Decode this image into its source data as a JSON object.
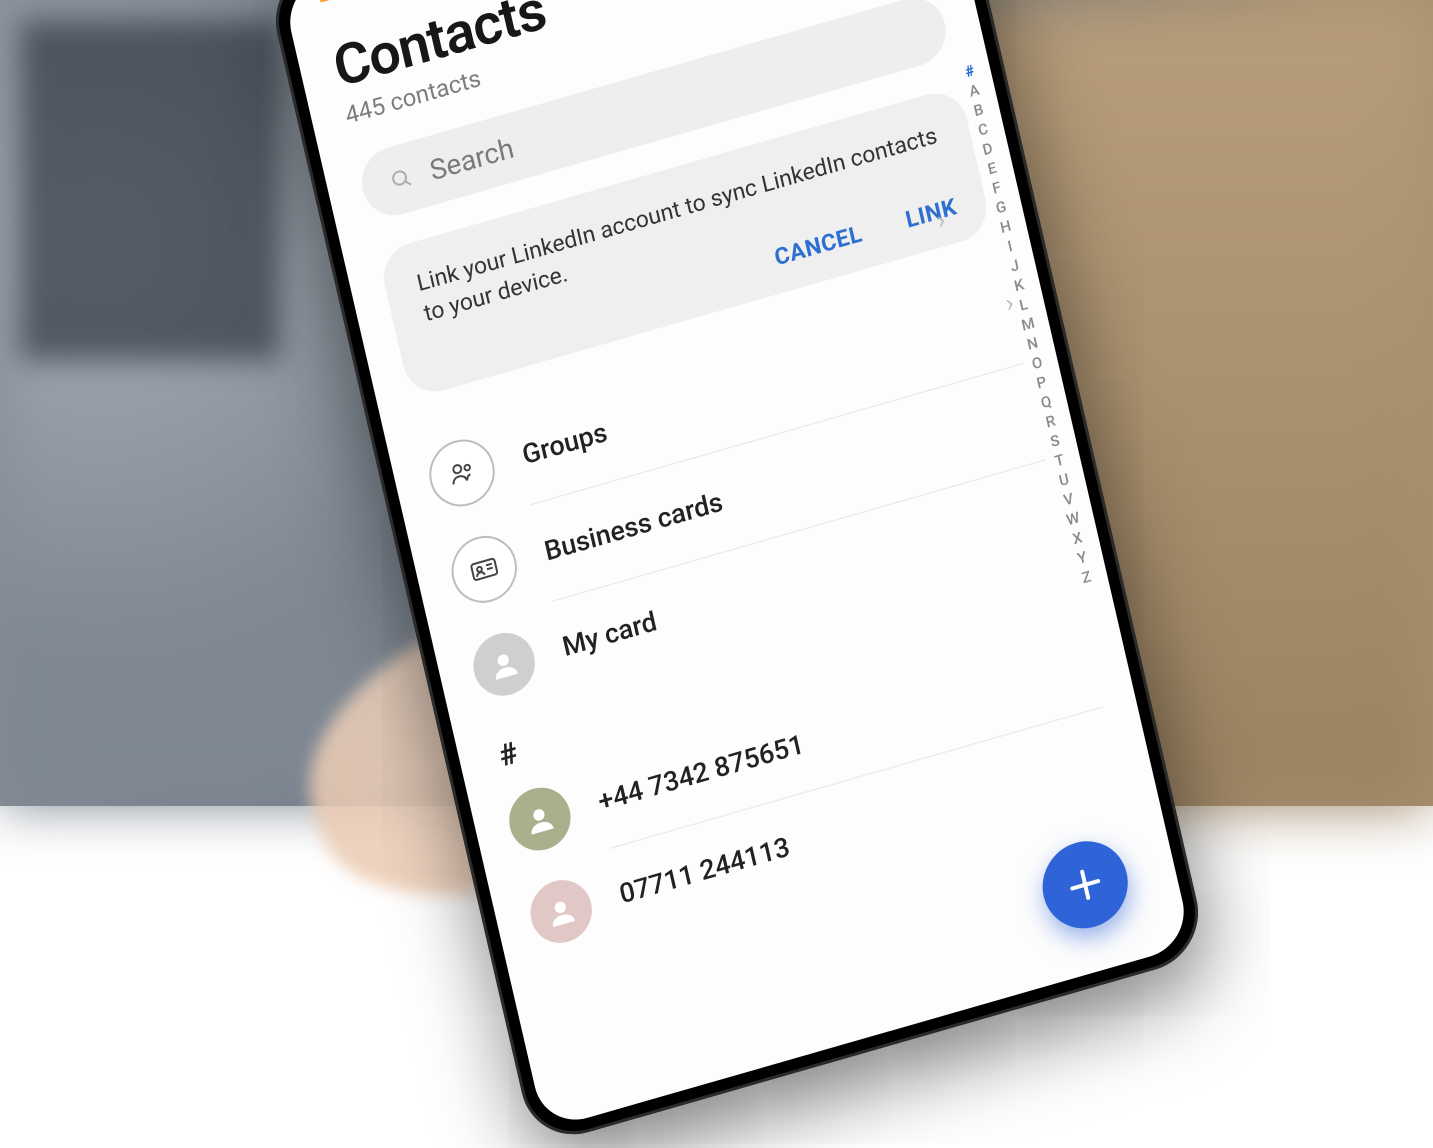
{
  "header": {
    "title": "Contacts",
    "subtitle": "445 contacts"
  },
  "search": {
    "placeholder": "Search"
  },
  "linked_card": {
    "message": "Link your LinkedIn account to sync LinkedIn contacts to your device.",
    "cancel": "CANCEL",
    "link": "LINK"
  },
  "quick_rows": {
    "groups": "Groups",
    "business_cards": "Business cards",
    "my_card": "My card"
  },
  "section_letter": "#",
  "contacts": [
    {
      "name": "+44 7342  875651"
    },
    {
      "name": "07711 244113"
    }
  ],
  "alpha_index": [
    "#",
    "A",
    "B",
    "C",
    "D",
    "E",
    "F",
    "G",
    "H",
    "I",
    "J",
    "K",
    "L",
    "M",
    "N",
    "O",
    "P",
    "Q",
    "R",
    "S",
    "T",
    "U",
    "V",
    "W",
    "X",
    "Y",
    "Z"
  ],
  "colors": {
    "accent": "#2f64d8",
    "link_text": "#2f6fd0"
  }
}
